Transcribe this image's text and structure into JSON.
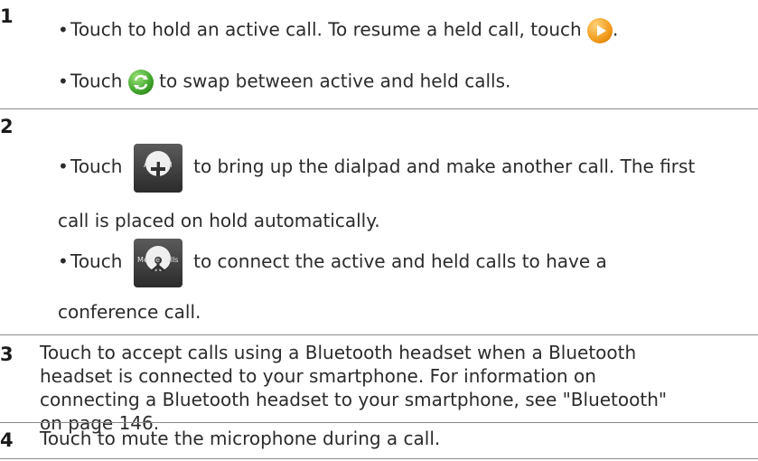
{
  "rows": [
    {
      "num": "1",
      "hold_text_a": "Touch to hold an active call. To resume a held call, touch",
      "hold_text_b": ".",
      "swap_a": "Touch",
      "swap_b": "to swap between active and held calls."
    },
    {
      "num": "2",
      "add_a": "Touch",
      "add_b": "to bring up the dialpad and make another call. The first",
      "add_c": "call is placed on hold automatically.",
      "add_icon_label": "Add call",
      "merge_a": "Touch",
      "merge_b": "to connect the active and held calls to have a",
      "merge_c": "conference call.",
      "merge_icon_label": "Merge calls"
    },
    {
      "num": "3",
      "l1": "Touch to accept calls using a Bluetooth headset when a Bluetooth",
      "l2": "headset is connected to your smartphone. For information on",
      "l3": "connecting a Bluetooth headset to your smartphone, see \"Bluetooth\"",
      "l4": "on page 146."
    },
    {
      "num": "4",
      "l1": "Touch to mute the microphone during a call."
    }
  ],
  "colors": {
    "rule": "#8a8a8a",
    "text": "#2b2b2b"
  },
  "icons": [
    "play-icon",
    "swap-icon",
    "add-call-icon",
    "merge-calls-icon"
  ]
}
